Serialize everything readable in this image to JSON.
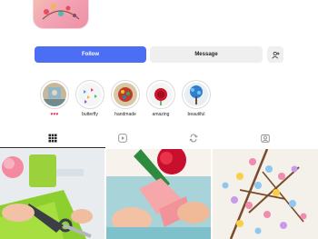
{
  "profile": {
    "actions": {
      "follow": "Follow",
      "message": "Message",
      "suggest_icon": "add-person-icon"
    }
  },
  "highlights": [
    {
      "label": "♥♥♥",
      "label_color": "#e0245e"
    },
    {
      "label": "butterfly"
    },
    {
      "label": "handmade"
    },
    {
      "label": "amazing"
    },
    {
      "label": "beautiful"
    }
  ],
  "tabs": [
    {
      "icon": "grid-icon",
      "active": true
    },
    {
      "icon": "reels-icon",
      "active": false
    },
    {
      "icon": "repost-icon",
      "active": false
    },
    {
      "icon": "tagged-icon",
      "active": false
    }
  ],
  "colors": {
    "accent": "#4c6ef5",
    "secondary_button": "#efefef",
    "text": "#262626"
  }
}
